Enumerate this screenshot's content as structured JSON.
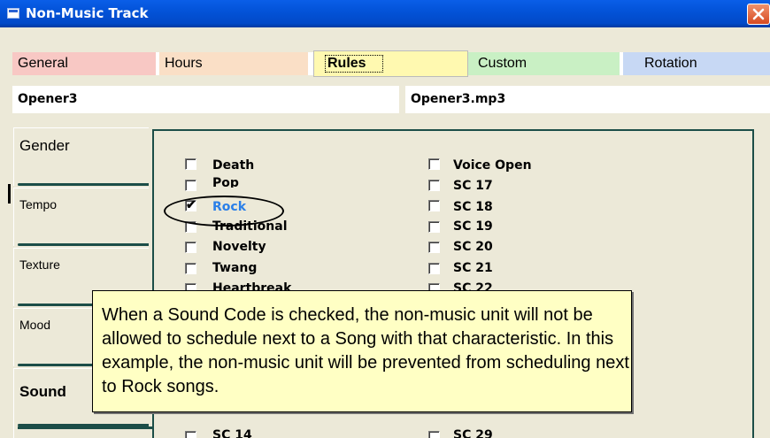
{
  "window": {
    "title": "Non-Music Track",
    "icon": "window-icon",
    "close_icon": "close-icon"
  },
  "tabs": [
    {
      "label": "General",
      "color": "#f8c8c4"
    },
    {
      "label": "Hours",
      "color": "#fadfc6"
    },
    {
      "label": "Rules",
      "color": "#fff9b0",
      "selected": true
    },
    {
      "label": "Custom",
      "color": "#c9f0c4"
    },
    {
      "label": "Rotation",
      "color": "#c7d8f4"
    }
  ],
  "fields": {
    "title": "Opener3",
    "filename": "Opener3.mp3"
  },
  "side_tabs": [
    {
      "label": "Gender"
    },
    {
      "label": "Tempo"
    },
    {
      "label": "Texture"
    },
    {
      "label": "Mood"
    },
    {
      "label": "Sound",
      "selected": true
    }
  ],
  "sound_codes": {
    "left": [
      {
        "label": "Death",
        "checked": false
      },
      {
        "label": "Pop",
        "checked": false
      },
      {
        "label": "Rock",
        "checked": true
      },
      {
        "label": "Traditional",
        "checked": false
      },
      {
        "label": "Novelty",
        "checked": false
      },
      {
        "label": "Twang",
        "checked": false
      },
      {
        "label": "Heartbreak",
        "checked": false
      },
      {
        "label": "SC 14",
        "checked": false
      }
    ],
    "right": [
      {
        "label": "Voice Open",
        "checked": false
      },
      {
        "label": "SC 17",
        "checked": false
      },
      {
        "label": "SC 18",
        "checked": false
      },
      {
        "label": "SC 19",
        "checked": false
      },
      {
        "label": "SC 20",
        "checked": false
      },
      {
        "label": "SC 21",
        "checked": false
      },
      {
        "label": "SC 22",
        "checked": false
      },
      {
        "label": "SC 29",
        "checked": false
      }
    ]
  },
  "callout": {
    "text": "When a Sound Code is checked, the non-music unit will not be allowed to schedule next to a Song with that characteristic.  In this example, the non-music unit will be prevented from scheduling next to Rock songs."
  },
  "colors": {
    "titlebar": "#0353d8",
    "checked_label": "#2a7fe8",
    "callout_bg": "#ffffc4",
    "panel_border": "#1c4e48"
  }
}
